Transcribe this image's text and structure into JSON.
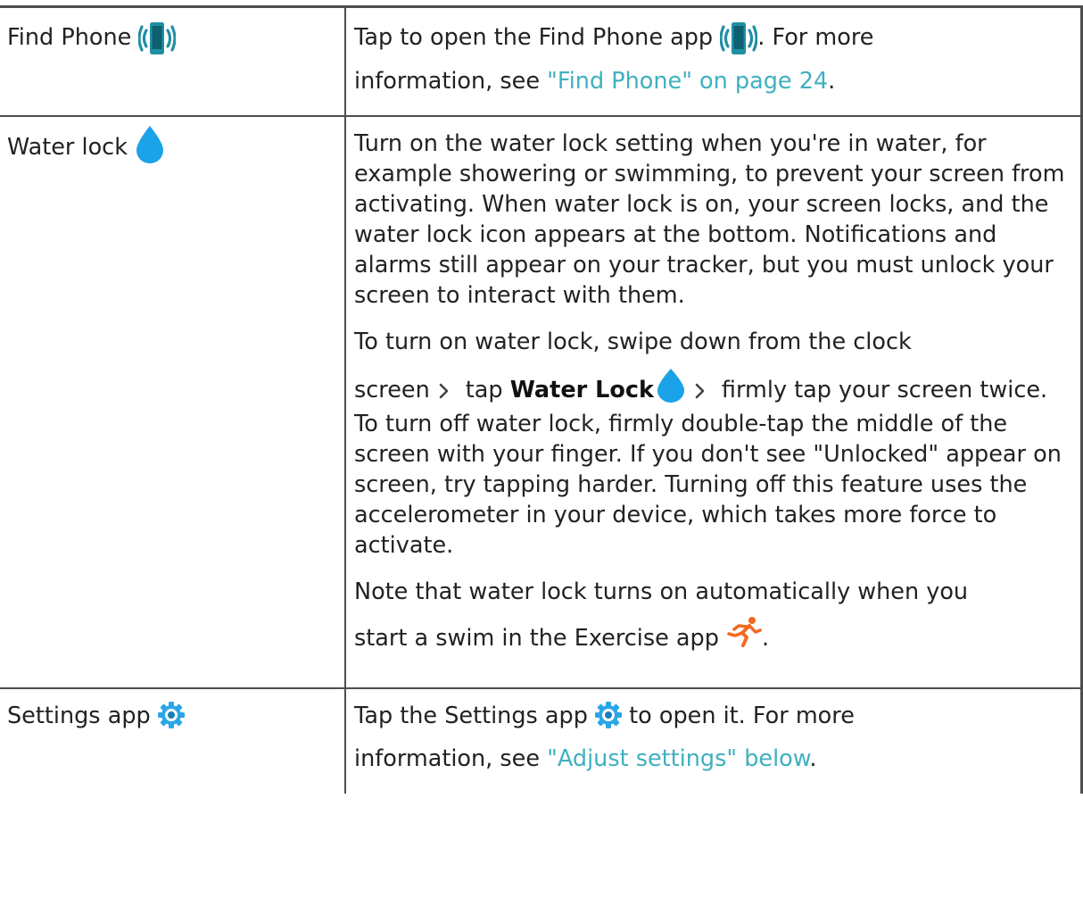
{
  "rows": [
    {
      "label": "Find Phone",
      "icon": "phone-vibrate-icon",
      "desc_before_icon": "Tap to open the Find Phone app ",
      "desc_after_icon": ". For more",
      "desc_line2_prefix": "information, see ",
      "link": "\"Find Phone\" on page 24",
      "desc_line2_suffix": "."
    },
    {
      "label": "Water lock",
      "icon": "water-drop-icon",
      "para1": "Turn on the water lock setting when you're in water, for example showering or swimming, to prevent your screen from activating. When water lock is on, your screen locks, and the water lock icon appears at the bottom. Notifications and alarms still appear on your tracker, but you must unlock your screen to interact with them.",
      "para2_line1": "To turn on water lock, swipe down from the clock",
      "para2_screen": "screen",
      "para2_tap": "tap ",
      "para2_bold": "Water Lock",
      "para2_firmly": "firmly tap your",
      "para2_rest": "screen twice. To turn off water lock, firmly double-tap the middle of the screen with your finger. If you don't see \"Unlocked\" appear on screen, try tapping harder. Turning off this feature uses the accelerometer in your device, which takes more force to activate.",
      "para3_line1": "Note that water lock turns on automatically when you",
      "para3_line2": "start a swim in the Exercise app ",
      "para3_end": "."
    },
    {
      "label": "Settings app ",
      "icon": "gear-icon",
      "desc_before_icon": "Tap the Settings app ",
      "desc_after_icon": " to open it. For more",
      "desc_line2_prefix": "information, see ",
      "link": "\"Adjust settings\" below",
      "desc_line2_suffix": "."
    }
  ],
  "colors": {
    "link": "#3fb0c1",
    "water_drop": "#1aa3e8",
    "phone_icon": "#1f8fa3",
    "gear_icon": "#2aa6e6",
    "runner_icon": "#f26a21",
    "border": "#4d4d4d"
  }
}
